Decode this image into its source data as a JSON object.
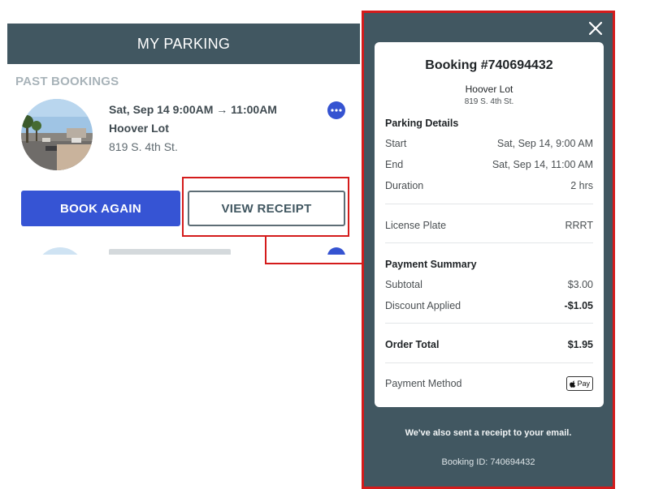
{
  "app": {
    "header_title": "MY PARKING",
    "section_label": "PAST BOOKINGS"
  },
  "booking": {
    "datetime": "Sat, Sep 14 9:00AM → 11:00AM",
    "lot_name": "Hoover Lot",
    "address": "819 S. 4th St.",
    "book_again_label": "BOOK AGAIN",
    "view_receipt_label": "VIEW RECEIPT"
  },
  "receipt": {
    "title": "Booking #740694432",
    "lot_name": "Hoover Lot",
    "address": "819 S. 4th St.",
    "parking_details_heading": "Parking Details",
    "details": [
      {
        "label": "Start",
        "value": "Sat, Sep 14, 9:00 AM"
      },
      {
        "label": "End",
        "value": "Sat, Sep 14, 11:00 AM"
      },
      {
        "label": "Duration",
        "value": "2 hrs"
      }
    ],
    "license_plate_label": "License Plate",
    "license_plate_value": "RRRT",
    "payment_summary_heading": "Payment Summary",
    "subtotal_label": "Subtotal",
    "subtotal_value": "$3.00",
    "discount_label": "Discount Applied",
    "discount_value": "-$1.05",
    "order_total_label": "Order Total",
    "order_total_value": "$1.95",
    "payment_method_label": "Payment Method",
    "payment_method_badge": "Pay",
    "footer_message": "We've also sent a receipt to your email.",
    "footer_booking_id": "Booking ID: 740694432"
  },
  "colors": {
    "header_bg": "#415761",
    "primary_button": "#3654d4",
    "highlight": "#d41b1b"
  },
  "icons": {
    "more": "more-horizontal-icon",
    "close": "close-icon",
    "apple": "apple-icon"
  }
}
